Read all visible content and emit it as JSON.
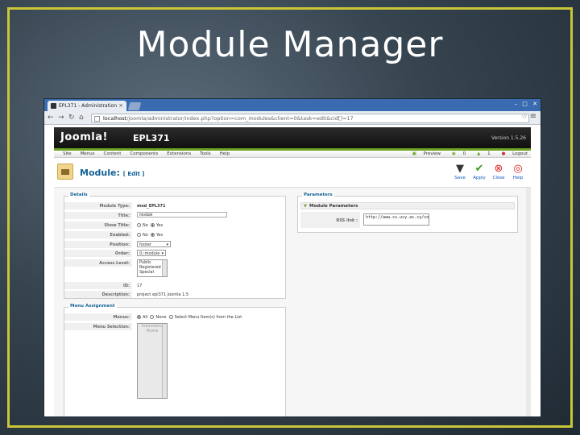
{
  "slide": {
    "title": "Module Manager"
  },
  "browser": {
    "tab_title": "EPL371 - Administration",
    "tab_close": "×",
    "url_host": "localhost",
    "url_path": "/joomla/administrator/index.php?option=com_modules&client=0&task=edit&cid[]=17",
    "nav_back": "←",
    "nav_forward": "→",
    "nav_reload": "↻",
    "nav_home": "⌂",
    "star": "☆",
    "menu": "≡",
    "win_min": "–",
    "win_max": "□",
    "win_close": "✕"
  },
  "joomla": {
    "logo": "Joomla!",
    "site_name": "EPL371",
    "version": "Version 1.5.26",
    "menu": [
      "Site",
      "Menus",
      "Content",
      "Components",
      "Extensions",
      "Tools",
      "Help"
    ],
    "right": {
      "preview": "Preview",
      "messages": "0",
      "users": "1",
      "logout": "Logout"
    }
  },
  "toolbar": {
    "title": "Module:",
    "subtitle": "[ Edit ]",
    "buttons": {
      "save": "Save",
      "apply": "Apply",
      "close": "Close",
      "help": "Help"
    }
  },
  "details": {
    "legend": "Details",
    "module_type_label": "Module Type:",
    "module_type": "mod_EPL371",
    "title_label": "Title:",
    "title_value": "module",
    "show_title_label": "Show Title:",
    "enabled_label": "Enabled:",
    "no": "No",
    "yes": "Yes",
    "position_label": "Position:",
    "position_value": "footer",
    "order_label": "Order:",
    "order_value": "0::module",
    "access_label": "Access Level:",
    "access_options": [
      "Public",
      "Registered",
      "Special"
    ],
    "id_label": "ID:",
    "id_value": "17",
    "description_label": "Description:",
    "description_value": "project epl371 joomla 1.5"
  },
  "menu_assignment": {
    "legend": "Menu Assignment",
    "menus_label": "Menus:",
    "opt_all": "All",
    "opt_none": "None",
    "opt_select": "Select Menu Item(s) from the List",
    "selection_label": "Menu Selection:",
    "selection_items": [
      "mainmenu",
      "Home"
    ]
  },
  "parameters": {
    "legend": "Parameters",
    "section": "Module Parameters",
    "rss_label": "RSS link :",
    "rss_value": "http://www.cs.ucy.ac.cy/colloquium/rss.xml"
  }
}
